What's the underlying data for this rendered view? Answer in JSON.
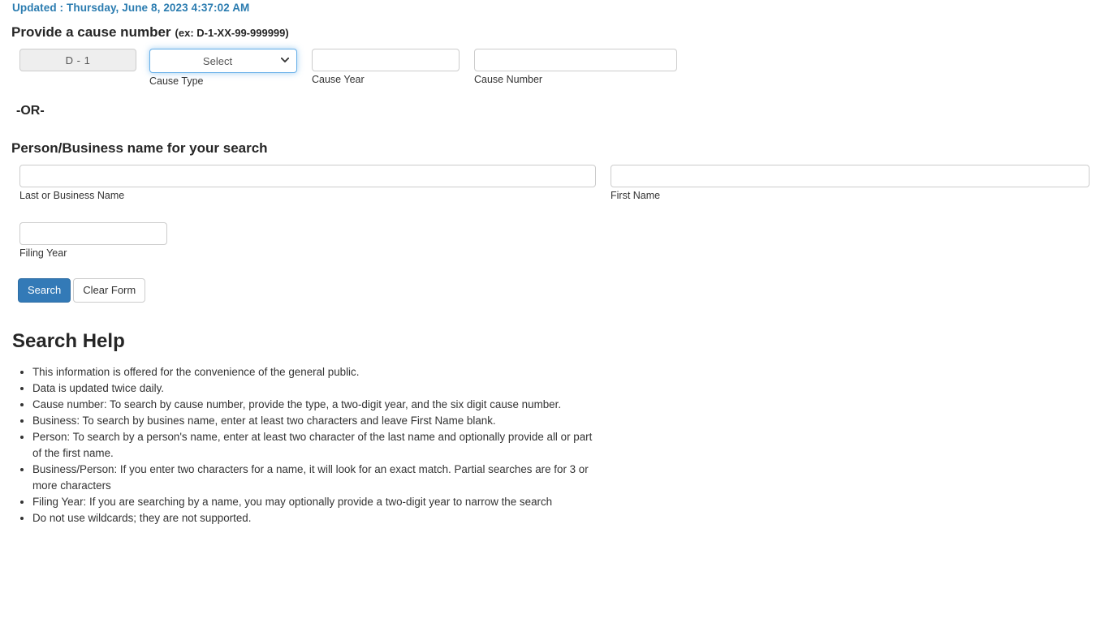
{
  "header": {
    "updated_text": "Updated : Thursday, June 8, 2023 4:37:02 AM",
    "updated_color": "#2b7cb0"
  },
  "cause_section": {
    "heading": "Provide a cause number",
    "example": "(ex: D-1-XX-99-999999)",
    "prefix": {
      "value": "D - 1",
      "label": ""
    },
    "cause_type": {
      "selected": "Select",
      "label": "Cause Type",
      "options": [
        "Select"
      ]
    },
    "cause_year": {
      "value": "",
      "placeholder": "",
      "label": "Cause Year"
    },
    "cause_number": {
      "value": "",
      "placeholder": "",
      "label": "Cause Number"
    }
  },
  "divider": {
    "or_text": "-OR-"
  },
  "name_section": {
    "heading": "Person/Business name for your search",
    "last_name": {
      "value": "",
      "placeholder": "",
      "label": "Last or Business Name"
    },
    "first_name": {
      "value": "",
      "placeholder": "",
      "label": "First Name"
    },
    "filing_year": {
      "value": "",
      "placeholder": "",
      "label": "Filing Year"
    }
  },
  "actions": {
    "search_label": "Search",
    "clear_label": "Clear Form",
    "search_color": "#337ab7"
  },
  "help": {
    "heading": "Search Help",
    "items": [
      "This information is offered for the convenience of the general public.",
      "Data is updated twice daily.",
      "Cause number: To search by cause number, provide the type, a two-digit year, and the six digit cause number.",
      "Business: To search by busines name, enter at least two characters and leave First Name blank.",
      "Person: To search by a person's name, enter at least two character of the last name and optionally provide all or part of the first name.",
      "Business/Person: If you enter two characters for a name, it will look for an exact match. Partial searches are for 3 or more characters",
      "Filing Year: If you are searching by a name, you may optionally provide a two-digit year to narrow the search",
      "Do not use wildcards; they are not supported."
    ]
  }
}
